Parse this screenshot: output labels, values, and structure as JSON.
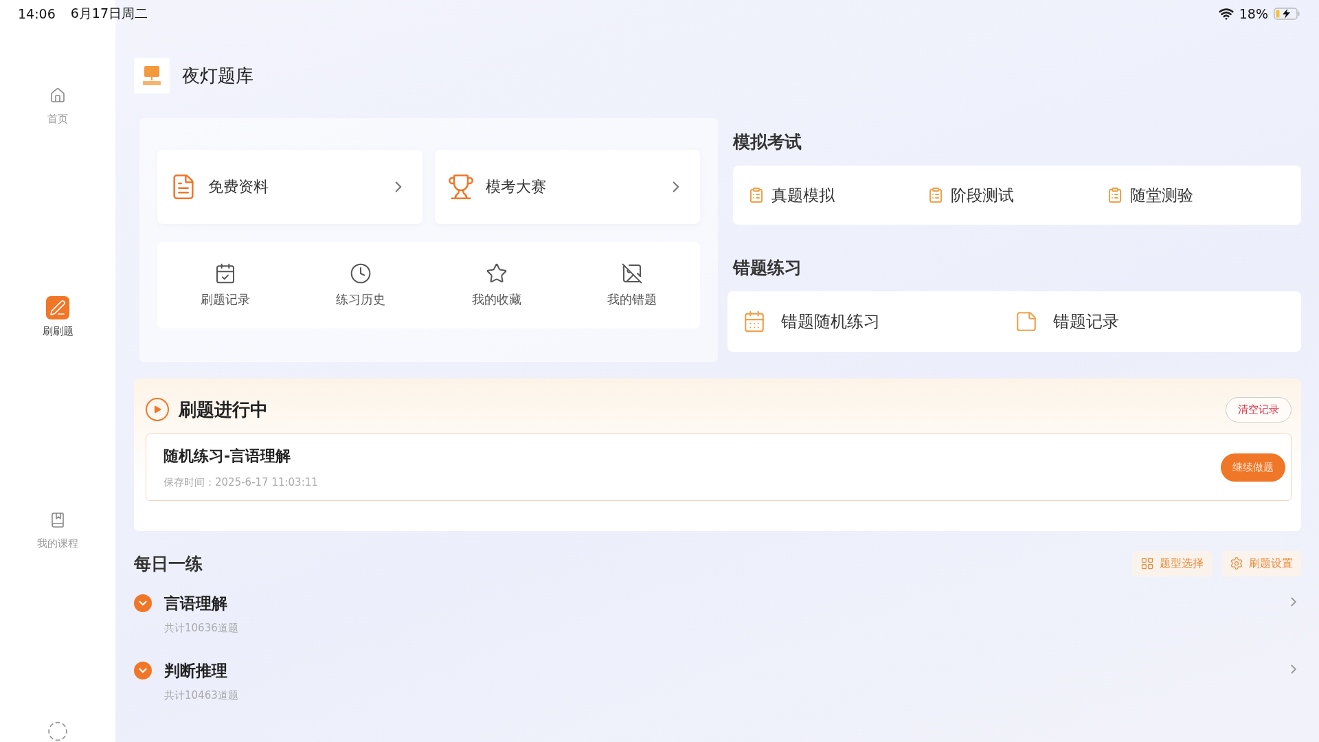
{
  "status_bar": {
    "time": "14:06",
    "date": "6月17日周二",
    "battery": "18%"
  },
  "sidebar": {
    "items": [
      {
        "label": "首页",
        "selected": false
      },
      {
        "label": "刷刷题",
        "selected": true
      },
      {
        "label": "我的课程",
        "selected": false
      }
    ]
  },
  "header": {
    "title": "夜灯题库"
  },
  "shortcuts": [
    {
      "label": "免费资料"
    },
    {
      "label": "模考大赛"
    }
  ],
  "tools": [
    {
      "label": "刷题记录"
    },
    {
      "label": "练习历史"
    },
    {
      "label": "我的收藏"
    },
    {
      "label": "我的错题"
    }
  ],
  "mock_exam": {
    "title": "模拟考试",
    "items": [
      "真题模拟",
      "阶段测试",
      "随堂测验"
    ]
  },
  "wrong_practice": {
    "title": "错题练习",
    "items": [
      {
        "label": "错题随机练习"
      },
      {
        "label": "错题记录"
      }
    ]
  },
  "in_progress": {
    "title": "刷题进行中",
    "clear_button": "清空记录",
    "session": {
      "title": "随机练习-言语理解",
      "saved": "保存时间：2025-6-17 11:03:11",
      "button": "继续做题"
    }
  },
  "daily": {
    "title": "每日一练",
    "actions": [
      {
        "label": "题型选择"
      },
      {
        "label": "刷题设置"
      }
    ],
    "items": [
      {
        "title": "言语理解",
        "count": "共计10636道题"
      },
      {
        "title": "判断推理",
        "count": "共计10463道题"
      }
    ]
  }
}
